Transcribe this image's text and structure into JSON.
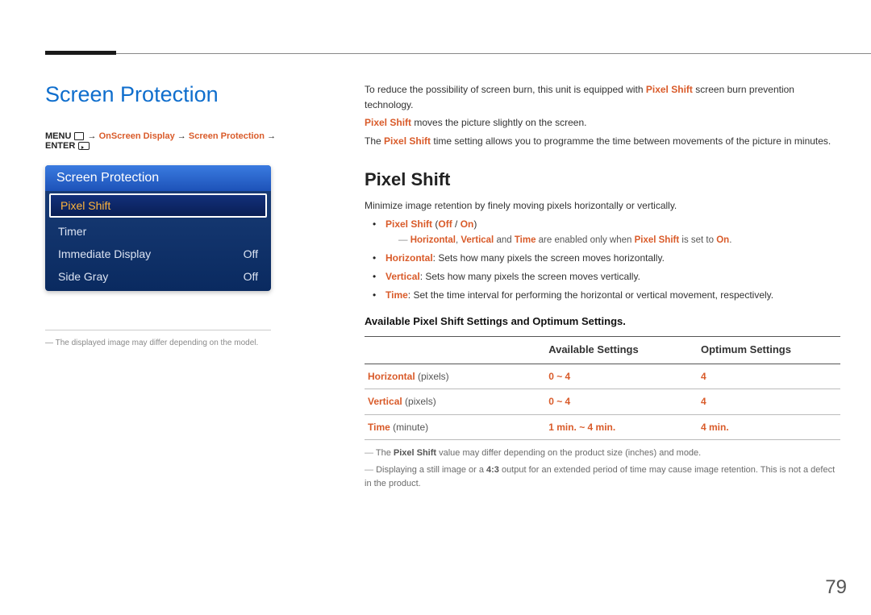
{
  "page_number": "79",
  "left": {
    "section_title": "Screen Protection",
    "breadcrumb": {
      "menu": "MENU",
      "arrow": "→",
      "p1": "OnScreen Display",
      "p2": "Screen Protection",
      "enter": "ENTER"
    },
    "panel": {
      "header": "Screen Protection",
      "rows": [
        {
          "label": "Pixel Shift",
          "value": "",
          "selected": true
        },
        {
          "label": "Timer",
          "value": "",
          "selected": false
        },
        {
          "label": "Immediate Display",
          "value": "Off",
          "selected": false
        },
        {
          "label": "Side Gray",
          "value": "Off",
          "selected": false
        }
      ]
    },
    "footnote": "The displayed image may differ depending on the model."
  },
  "right": {
    "intro1_a": "To reduce the possibility of screen burn, this unit is equipped with ",
    "intro1_b": "Pixel Shift",
    "intro1_c": " screen burn prevention technology.",
    "intro2_a": "Pixel Shift",
    "intro2_b": " moves the picture slightly on the screen.",
    "intro3_a": "The ",
    "intro3_b": "Pixel Shift",
    "intro3_c": " time setting allows you to programme the time between movements of the picture in minutes.",
    "heading": "Pixel Shift",
    "sub_text": "Minimize image retention by finely moving pixels horizontally or vertically.",
    "bullet1_a": "Pixel Shift",
    "bullet1_b": " (",
    "bullet1_c": "Off",
    "bullet1_d": " / ",
    "bullet1_e": "On",
    "bullet1_f": ")",
    "sub1_a": "Horizontal",
    "sub1_b": ", ",
    "sub1_c": "Vertical",
    "sub1_d": " and ",
    "sub1_e": "Time",
    "sub1_f": " are enabled only when ",
    "sub1_g": "Pixel Shift",
    "sub1_h": " is set to ",
    "sub1_i": "On",
    "sub1_j": ".",
    "bullet2_a": "Horizontal",
    "bullet2_b": ": Sets how many pixels the screen moves horizontally.",
    "bullet3_a": "Vertical",
    "bullet3_b": ": Sets how many pixels the screen moves vertically.",
    "bullet4_a": "Time",
    "bullet4_b": ": Set the time interval for performing the horizontal or vertical movement, respectively.",
    "table_title": "Available Pixel Shift Settings and Optimum Settings.",
    "table": {
      "headers": [
        "",
        "Available Settings",
        "Optimum Settings"
      ],
      "rows": [
        {
          "label": "Horizontal",
          "label_extra": " (pixels)",
          "avail": "0 ~ 4",
          "opt": "4"
        },
        {
          "label": "Vertical",
          "label_extra": " (pixels)",
          "avail": "0 ~ 4",
          "opt": "4"
        },
        {
          "label": "Time",
          "label_extra": " (minute)",
          "avail": "1 min. ~ 4 min.",
          "opt": "4 min."
        }
      ]
    },
    "note1_a": "The ",
    "note1_b": "Pixel Shift",
    "note1_c": " value may differ depending on the product size (inches) and mode.",
    "note2_a": "Displaying a still image or a ",
    "note2_b": "4:3",
    "note2_c": " output for an extended period of time may cause image retention. This is not a defect in the product."
  }
}
